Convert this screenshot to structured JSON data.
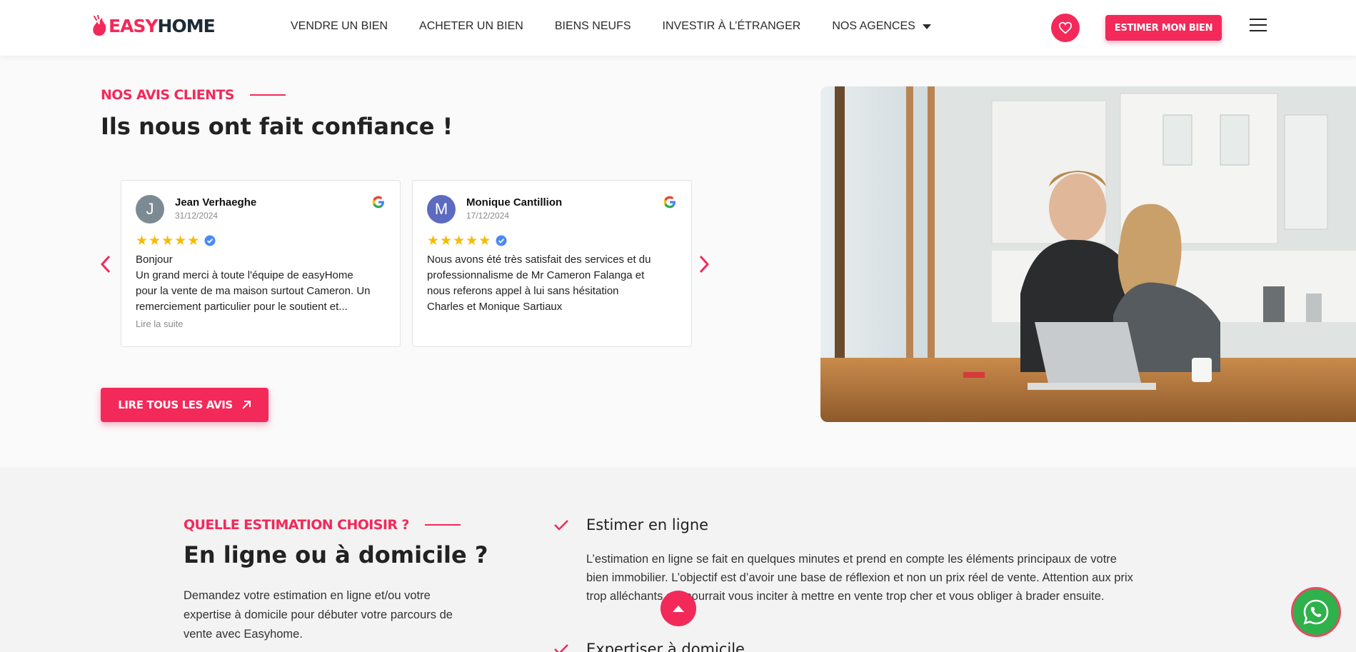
{
  "header": {
    "logo_part1": "EASY",
    "logo_part2": "HOME",
    "nav": [
      "VENDRE UN BIEN",
      "ACHETER UN BIEN",
      "BIENS NEUFS",
      "INVESTIR À L’ÉTRANGER",
      "NOS AGENCES"
    ],
    "cta_label": "ESTIMER MON BIEN",
    "icons": {
      "favorites": "heart-icon",
      "menu": "hamburger-menu-icon",
      "dropdown": "caret-down-icon"
    }
  },
  "reviews": {
    "eyebrow": "NOS AVIS CLIENTS",
    "title": "Ils nous ont fait confiance !",
    "items": [
      {
        "initial": "J",
        "avatar_color": "#7c8a93",
        "name": "Jean Verhaeghe",
        "date": "31/12/2024",
        "rating": 5,
        "text_lines": [
          "Bonjour",
          "Un grand merci à toute l'équipe de easyHome",
          "pour la vente de ma maison surtout Cameron. Un",
          "remerciement particulier pour le soutient et..."
        ],
        "more_label": "Lire la suite"
      },
      {
        "initial": "M",
        "avatar_color": "#5c6bc0",
        "name": "Monique Cantillion",
        "date": "17/12/2024",
        "rating": 5,
        "text_lines": [
          "Nous avons été très satisfait des services et du",
          "professionnalisme de Mr Cameron Falanga et",
          "nous referons appel à lui sans hésitation",
          "Charles et Monique Sartiaux"
        ],
        "more_label": ""
      }
    ],
    "all_reviews_label": "LIRE TOUS LES AVIS"
  },
  "estimation": {
    "eyebrow": "QUELLE ESTIMATION CHOISIR ?",
    "title": "En ligne ou à domicile ?",
    "description_lines": [
      "Demandez votre estimation en ligne et/ou votre",
      "expertise à domicile pour débuter votre parcours de",
      "vente avec Easyhome."
    ],
    "options": [
      {
        "title": "Estimer en ligne",
        "description_lines": [
          "L’estimation en ligne se fait en quelques minutes et prend en compte les éléments principaux de votre",
          "bien immobilier. L’objectif est d’avoir une base de réflexion et non un prix réel de vente. Attention aux prix",
          "trop alléchants qui pourrait vous inciter à mettre en vente trop cher et vous obliger à brader ensuite."
        ]
      },
      {
        "title": "Expertiser à domicile"
      }
    ]
  },
  "colors": {
    "accent": "#f3295a",
    "dark": "#1d2b36",
    "whatsapp": "#2fb14b",
    "star": "#f6bb06"
  }
}
